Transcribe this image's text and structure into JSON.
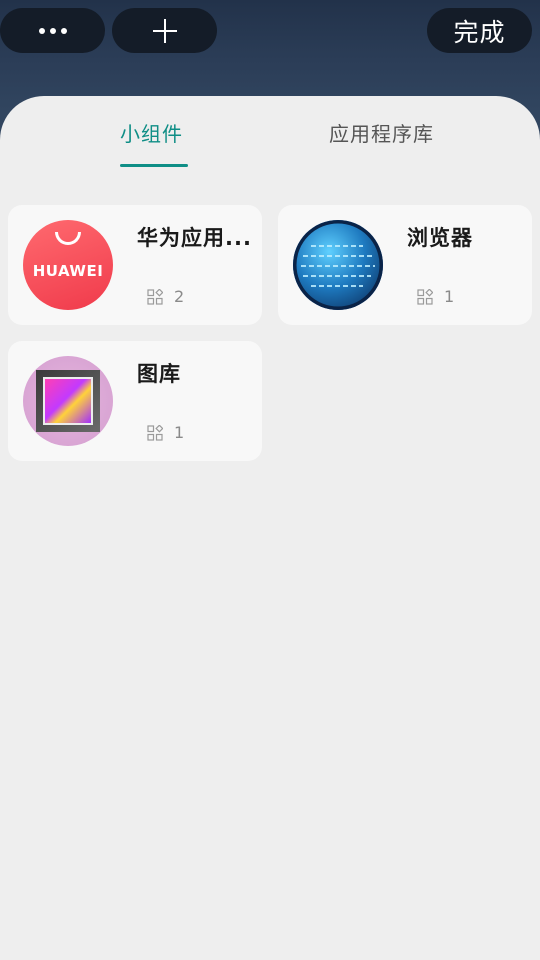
{
  "topbar": {
    "more_icon": "more-horizontal-icon",
    "add_icon": "plus-icon",
    "done_label": "完成"
  },
  "tabs": [
    {
      "label": "小组件",
      "active": true
    },
    {
      "label": "应用程序库",
      "active": false
    }
  ],
  "colors": {
    "accent": "#0f8e86",
    "sheet_background": "#eeeeee",
    "card_background": "#f8f8f8"
  },
  "apps": [
    {
      "name": "华为应用...",
      "icon": "huawei-appgallery-icon",
      "icon_text": "HUAWEI",
      "widget_count": "2"
    },
    {
      "name": "浏览器",
      "icon": "browser-globe-icon",
      "widget_count": "1"
    },
    {
      "name": "图库",
      "icon": "gallery-icon",
      "widget_count": "1"
    }
  ]
}
